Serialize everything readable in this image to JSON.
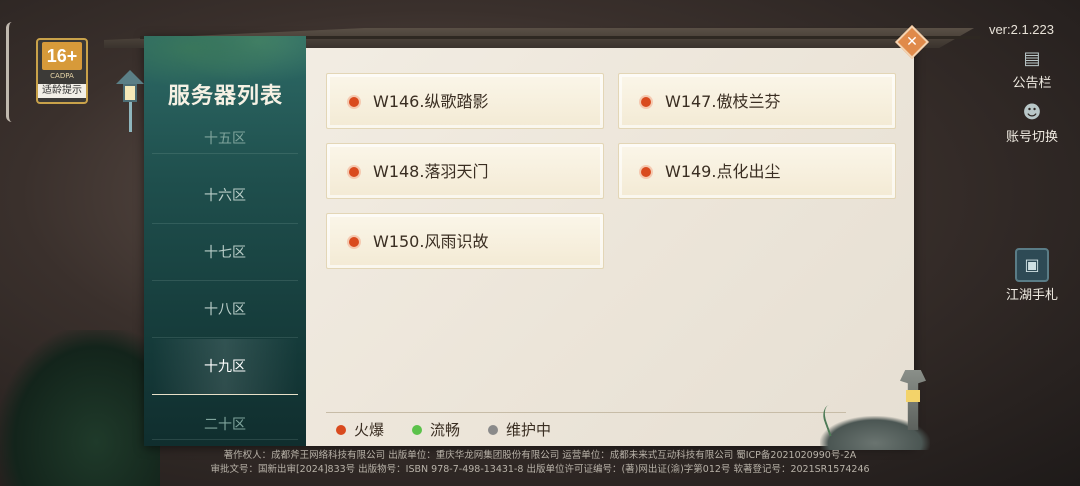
{
  "age_badge": {
    "rating": "16+",
    "org": "CADPA",
    "tip": "适龄提示"
  },
  "version": "ver:2.1.223",
  "right_menu": {
    "notice": "公告栏",
    "switch_account": "账号切换",
    "handbook": "江湖手札"
  },
  "panel": {
    "title": "服务器列表",
    "zones": [
      {
        "label": "十五区",
        "state": "faded"
      },
      {
        "label": "十六区",
        "state": "normal"
      },
      {
        "label": "十七区",
        "state": "normal"
      },
      {
        "label": "十八区",
        "state": "normal"
      },
      {
        "label": "十九区",
        "state": "active"
      },
      {
        "label": "二十区",
        "state": "faded"
      }
    ],
    "servers": [
      {
        "name": "W146.纵歌踏影",
        "status": "hot"
      },
      {
        "name": "W147.傲枝兰芬",
        "status": "hot"
      },
      {
        "name": "W148.落羽天门",
        "status": "hot"
      },
      {
        "name": "W149.点化出尘",
        "status": "hot"
      },
      {
        "name": "W150.风雨识故",
        "status": "hot"
      }
    ],
    "legend": [
      {
        "label": "火爆",
        "color": "#d94a1e"
      },
      {
        "label": "流畅",
        "color": "#5bc24a"
      },
      {
        "label": "维护中",
        "color": "#8a8a8a"
      }
    ]
  },
  "footer": {
    "line1": "著作权人：成都斧王网络科技有限公司 出版单位：重庆华龙网集团股份有限公司 运营单位：成都未来式互动科技有限公司 蜀ICP备2021020990号-2A",
    "line2": "审批文号：国新出审[2024]833号 出版物号：ISBN 978-7-498-13431-8 出版单位许可证编号：(著)网出证(渝)字第012号 软著登记号：2021SR1574246"
  },
  "colors": {
    "hot": "#d94a1e",
    "smooth": "#5bc24a",
    "maintenance": "#8a8a8a",
    "accent": "#e08a4a"
  }
}
